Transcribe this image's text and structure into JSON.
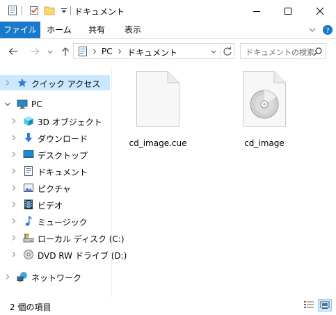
{
  "window": {
    "title": "ドキュメント"
  },
  "ribbon": {
    "tabs": [
      {
        "label": "ファイル"
      },
      {
        "label": "ホーム"
      },
      {
        "label": "共有"
      },
      {
        "label": "表示"
      }
    ]
  },
  "address": {
    "crumbs": [
      "PC",
      "ドキュメント"
    ]
  },
  "search": {
    "placeholder": "ドキュメントの検索"
  },
  "navpane": {
    "items": [
      {
        "label": "クイック アクセス",
        "icon": "star-icon"
      },
      {
        "label": "PC",
        "icon": "pc-icon"
      },
      {
        "label": "3D オブジェクト",
        "icon": "3d-objects-icon"
      },
      {
        "label": "ダウンロード",
        "icon": "download-icon"
      },
      {
        "label": "デスクトップ",
        "icon": "desktop-icon"
      },
      {
        "label": "ドキュメント",
        "icon": "documents-icon"
      },
      {
        "label": "ピクチャ",
        "icon": "pictures-icon"
      },
      {
        "label": "ビデオ",
        "icon": "videos-icon"
      },
      {
        "label": "ミュージック",
        "icon": "music-icon"
      },
      {
        "label": "ローカル ディスク (C:)",
        "icon": "local-disk-icon"
      },
      {
        "label": "DVD RW ドライブ (D:)",
        "icon": "dvd-drive-icon"
      },
      {
        "label": "ネットワーク",
        "icon": "network-icon"
      }
    ]
  },
  "files": [
    {
      "name": "cd_image.cue",
      "icon": "blank-file-icon"
    },
    {
      "name": "cd_image",
      "icon": "disc-image-file-icon"
    }
  ],
  "status": {
    "count_text": "2 個の項目"
  },
  "colors": {
    "accent": "#1979ca",
    "selection": "#cce8ff"
  }
}
